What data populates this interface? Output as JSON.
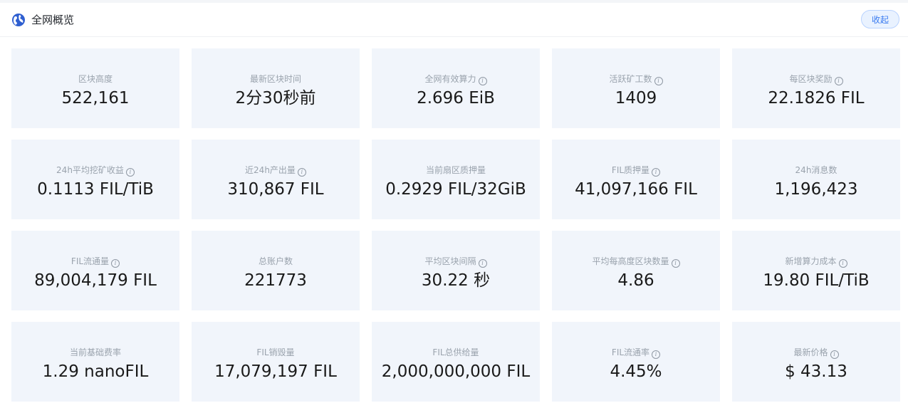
{
  "header": {
    "title": "全网概览",
    "collapse_label": "收起"
  },
  "stats": [
    {
      "label": "区块高度",
      "value": "522,161",
      "info": false
    },
    {
      "label": "最新区块时间",
      "value": "2分30秒前",
      "info": false
    },
    {
      "label": "全网有效算力",
      "value": "2.696 EiB",
      "info": true
    },
    {
      "label": "活跃矿工数",
      "value": "1409",
      "info": true
    },
    {
      "label": "每区块奖励",
      "value": "22.1826 FIL",
      "info": true
    },
    {
      "label": "24h平均挖矿收益",
      "value": "0.1113 FIL/TiB",
      "info": true
    },
    {
      "label": "近24h产出量",
      "value": "310,867 FIL",
      "info": true
    },
    {
      "label": "当前扇区质押量",
      "value": "0.2929 FIL/32GiB",
      "info": false
    },
    {
      "label": "FIL质押量",
      "value": "41,097,166 FIL",
      "info": true
    },
    {
      "label": "24h消息数",
      "value": "1,196,423",
      "info": false
    },
    {
      "label": "FIL流通量",
      "value": "89,004,179 FIL",
      "info": true
    },
    {
      "label": "总账户数",
      "value": "221773",
      "info": false
    },
    {
      "label": "平均区块间隔",
      "value": "30.22 秒",
      "info": true
    },
    {
      "label": "平均每高度区块数量",
      "value": "4.86",
      "info": true
    },
    {
      "label": "新增算力成本",
      "value": "19.80 FIL/TiB",
      "info": true
    },
    {
      "label": "当前基础费率",
      "value": "1.29 nanoFIL",
      "info": false
    },
    {
      "label": "FIL销毁量",
      "value": "17,079,197 FIL",
      "info": false
    },
    {
      "label": "FIL总供给量",
      "value": "2,000,000,000 FIL",
      "info": false
    },
    {
      "label": "FIL流通率",
      "value": "4.45%",
      "info": true
    },
    {
      "label": "最新价格",
      "value": "$ 43.13",
      "info": true
    }
  ],
  "icons": {
    "header": "globe-icon",
    "info": "info-icon"
  },
  "colors": {
    "accent": "#3a7bf0",
    "card_bg": "#f1f5fb",
    "label": "#9aa3ad",
    "value": "#1a1a1a"
  }
}
